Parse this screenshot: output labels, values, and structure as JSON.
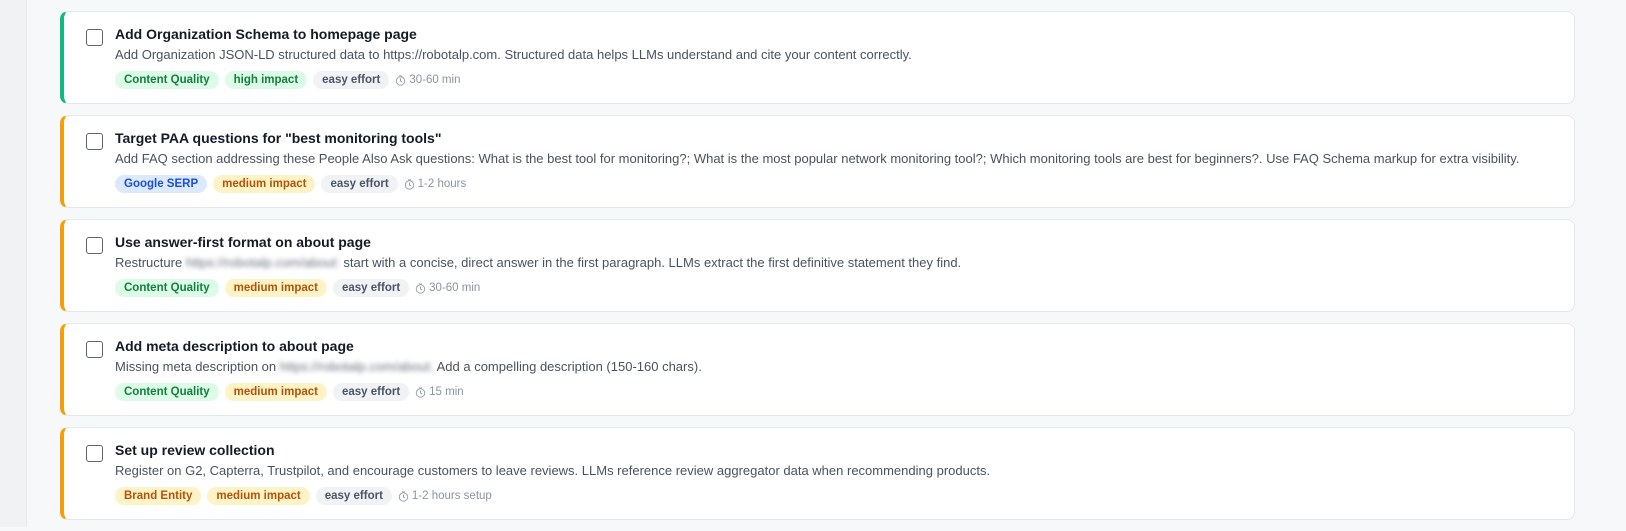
{
  "colors": {
    "accent_green": "#10b981",
    "accent_amber": "#f59e0b"
  },
  "items": [
    {
      "title": "Add Organization Schema to homepage page",
      "description": "Add Organization JSON-LD structured data to https://robotalp.com. Structured data helps LLMs understand and cite your content correctly.",
      "category": "Content Quality",
      "impact": "high impact",
      "effort": "easy effort",
      "time": "30-60 min",
      "checked": false
    },
    {
      "title": "Target PAA questions for \"best monitoring tools\"",
      "description": "Add FAQ section addressing these People Also Ask questions: What is the best tool for monitoring?; What is the most popular network monitoring tool?; Which monitoring tools are best for beginners?. Use FAQ Schema markup for extra visibility.",
      "category": "Google SERP",
      "impact": "medium impact",
      "effort": "easy effort",
      "time": "1-2 hours",
      "checked": false
    },
    {
      "title": "Use answer-first format on about page",
      "description_prefix": "Restructure",
      "description_url": "https://robotalp.com/about:",
      "description_suffix": "start with a concise, direct answer in the first paragraph. LLMs extract the first definitive statement they find.",
      "category": "Content Quality",
      "impact": "medium impact",
      "effort": "easy effort",
      "time": "30-60 min",
      "checked": false
    },
    {
      "title": "Add meta description to about page",
      "description_prefix": "Missing meta description on",
      "description_url": "https://robotalp.com/about.",
      "description_suffix": "Add a compelling description (150-160 chars).",
      "category": "Content Quality",
      "impact": "medium impact",
      "effort": "easy effort",
      "time": "15 min",
      "checked": false
    },
    {
      "title": "Set up review collection",
      "description": "Register on G2, Capterra, Trustpilot, and encourage customers to leave reviews. LLMs reference review aggregator data when recommending products.",
      "category": "Brand Entity",
      "impact": "medium impact",
      "effort": "easy effort",
      "time": "1-2 hours setup",
      "checked": false
    }
  ]
}
